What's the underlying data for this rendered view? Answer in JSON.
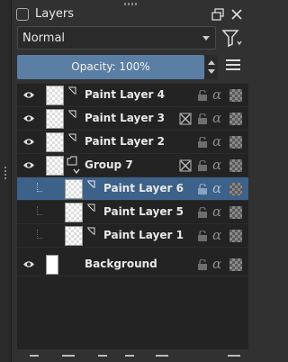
{
  "panel": {
    "title": "Layers"
  },
  "blend_mode": {
    "selected": "Normal"
  },
  "opacity": {
    "label": "Opacity:  100%"
  },
  "layers": [
    {
      "name": "Paint Layer 4",
      "type": "paint-layer-icon",
      "visible": true,
      "indent": 0,
      "active": false,
      "thumb": "checker",
      "has_x": false
    },
    {
      "name": "Paint Layer 3",
      "type": "paint-layer-icon",
      "visible": true,
      "indent": 0,
      "active": false,
      "thumb": "checker",
      "has_x": true
    },
    {
      "name": "Paint Layer 2",
      "type": "paint-layer-icon",
      "visible": true,
      "indent": 0,
      "active": false,
      "thumb": "checker",
      "has_x": false
    },
    {
      "name": "Group 7",
      "type": "group-layer-icon",
      "visible": true,
      "indent": 0,
      "active": false,
      "thumb": "checker",
      "has_x": true
    },
    {
      "name": "Paint Layer 6",
      "type": "paint-layer-icon",
      "visible": false,
      "indent": 1,
      "active": true,
      "thumb": "checker",
      "has_x": false
    },
    {
      "name": "Paint Layer 5",
      "type": "paint-layer-icon",
      "visible": false,
      "indent": 1,
      "active": false,
      "thumb": "checker",
      "has_x": false
    },
    {
      "name": "Paint Layer 1",
      "type": "paint-layer-icon",
      "visible": false,
      "indent": 1,
      "active": false,
      "thumb": "checker",
      "has_x": false
    },
    {
      "name": "Background",
      "type": "paint-layer-icon",
      "visible": true,
      "indent": 0,
      "active": false,
      "thumb": "white",
      "has_x": false
    }
  ],
  "colors": {
    "accent": "#5b7ea4",
    "active_row": "#3d6289",
    "list_bg": "#232323"
  }
}
